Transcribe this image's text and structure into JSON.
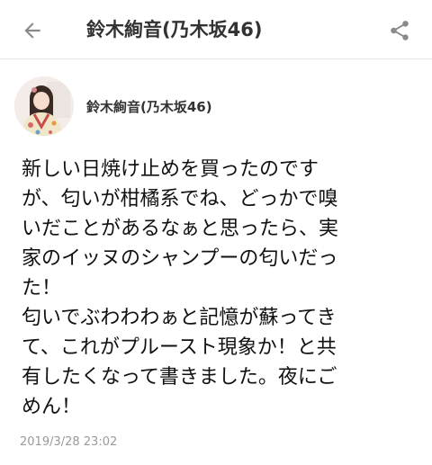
{
  "appbar": {
    "title": "鈴木絢音(乃木坂46)"
  },
  "author": {
    "name": "鈴木絢音(乃木坂46)"
  },
  "post": {
    "body": "新しい日焼け止めを買ったのです\nが、匂いが柑橘系でね、どっかで嗅\nいだことがあるなぁと思ったら、実\n家のイッヌのシャンプーの匂いだっ\nた！\n匂いでぶわわわぁと記憶が蘇ってき\nて、これがプルースト現象か！と共\n有したくなって書きました。夜にご\nめん！",
    "timestamp": "2019/3/28 23:02"
  },
  "icons": {
    "back": "arrow-back-icon",
    "share": "share-icon"
  },
  "colors": {
    "text": "#111111",
    "muted": "#9a9a9a",
    "icon": "#8a8a8a",
    "divider": "#e6e6e6"
  }
}
